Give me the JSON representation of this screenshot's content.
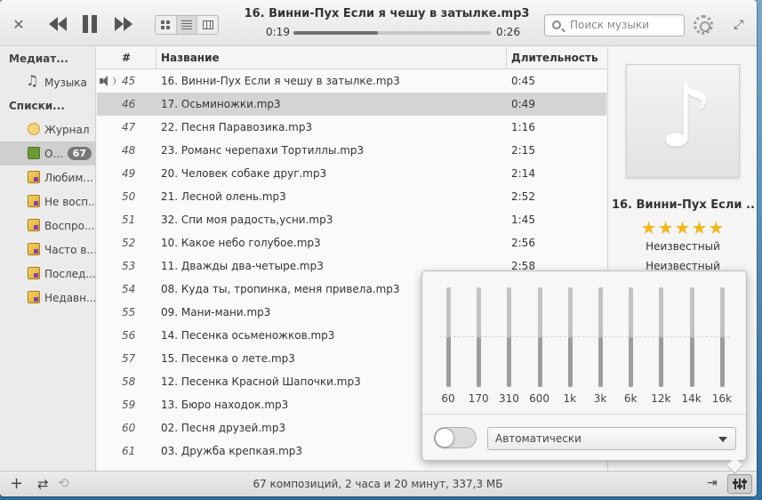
{
  "header": {
    "now_playing": "16. Винни-Пух Если я чешу в затылке.mp3",
    "time_current": "0:19",
    "time_total": "0:26",
    "progress": 0.43,
    "search_placeholder": "Поиск музыки"
  },
  "sidebar": {
    "library_heading": "Медиат...",
    "music_label": "Музыка",
    "playlists_heading": "Списки...",
    "items": [
      {
        "label": "Журнал",
        "icon": "journal-icon"
      },
      {
        "label": "О...",
        "icon": "playlist-icon",
        "badge": "67",
        "selected": true
      },
      {
        "label": "Любим...",
        "icon": "smart-playlist-icon"
      },
      {
        "label": "Не восп...",
        "icon": "smart-playlist-icon"
      },
      {
        "label": "Воспро...",
        "icon": "smart-playlist-icon"
      },
      {
        "label": "Часто в...",
        "icon": "smart-playlist-icon"
      },
      {
        "label": "Послед...",
        "icon": "smart-playlist-icon"
      },
      {
        "label": "Недавн...",
        "icon": "smart-playlist-icon"
      }
    ]
  },
  "list": {
    "col_num": "#",
    "col_title": "Название",
    "col_duration": "Длительность",
    "rows": [
      {
        "num": "45",
        "title": "16. Винни-Пух Если я чешу в затылке.mp3",
        "duration": "0:45",
        "playing": true
      },
      {
        "num": "46",
        "title": "17. Осьминожки.mp3",
        "duration": "0:49",
        "selected": true
      },
      {
        "num": "47",
        "title": "22. Песня Паравозика.mp3",
        "duration": "1:16"
      },
      {
        "num": "48",
        "title": "23. Романс черепахи Тортиллы.mp3",
        "duration": "2:15"
      },
      {
        "num": "49",
        "title": "20. Человек собаке друг.mp3",
        "duration": "2:14"
      },
      {
        "num": "50",
        "title": "21. Лесной олень.mp3",
        "duration": "2:52"
      },
      {
        "num": "51",
        "title": "32. Спи моя радость,усни.mp3",
        "duration": "1:45"
      },
      {
        "num": "52",
        "title": "10. Какое небо голубое.mp3",
        "duration": "2:56"
      },
      {
        "num": "53",
        "title": "11. Дважды два-четыре.mp3",
        "duration": "2:58"
      },
      {
        "num": "54",
        "title": "08. Куда ты, тропинка, меня привела.mp3",
        "duration": ""
      },
      {
        "num": "55",
        "title": "09. Мани-мани.mp3",
        "duration": ""
      },
      {
        "num": "56",
        "title": "14. Песенка осьменожков.mp3",
        "duration": ""
      },
      {
        "num": "57",
        "title": "15. Песенка о лете.mp3",
        "duration": ""
      },
      {
        "num": "58",
        "title": "12. Песенка Красной Шапочки.mp3",
        "duration": ""
      },
      {
        "num": "59",
        "title": "13. Бюро находок.mp3",
        "duration": ""
      },
      {
        "num": "60",
        "title": "02. Песня друзей.mp3",
        "duration": ""
      },
      {
        "num": "61",
        "title": "03. Дружба крепкая.mp3",
        "duration": ""
      }
    ]
  },
  "now_playing_pane": {
    "title": "16. Винни-Пух Если ...",
    "rating": 5,
    "stars": "★★★★★",
    "artist": "Неизвестный",
    "album": "Неизвестный"
  },
  "equalizer": {
    "bands": [
      {
        "label": "60",
        "level": 0.5
      },
      {
        "label": "170",
        "level": 0.5
      },
      {
        "label": "310",
        "level": 0.5
      },
      {
        "label": "600",
        "level": 0.5
      },
      {
        "label": "1k",
        "level": 0.5
      },
      {
        "label": "3k",
        "level": 0.5
      },
      {
        "label": "6k",
        "level": 0.5
      },
      {
        "label": "12k",
        "level": 0.5
      },
      {
        "label": "14k",
        "level": 0.5
      },
      {
        "label": "16k",
        "level": 0.5
      }
    ],
    "enabled": false,
    "preset": "Автоматически"
  },
  "statusbar": {
    "summary": "67 композиций, 2 часа и 20 минут, 337,3 МБ"
  },
  "colors": {
    "star": "#f3b71c",
    "selection": "#d4d4d4"
  }
}
